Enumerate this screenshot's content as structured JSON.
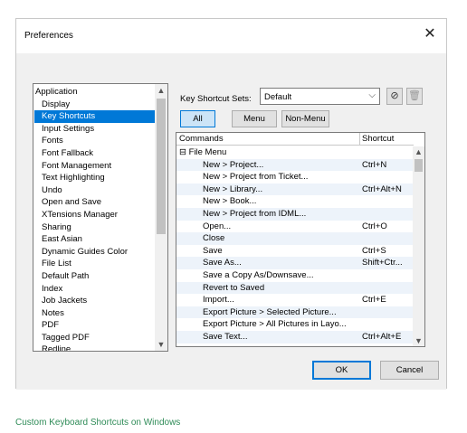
{
  "window": {
    "title": "Preferences",
    "close_glyph": "✕"
  },
  "categories": {
    "items": [
      {
        "label": "Application",
        "top": true,
        "selected": false
      },
      {
        "label": "Display",
        "top": false,
        "selected": false
      },
      {
        "label": "Key Shortcuts",
        "top": false,
        "selected": true
      },
      {
        "label": "Input Settings",
        "top": false,
        "selected": false
      },
      {
        "label": "Fonts",
        "top": false,
        "selected": false
      },
      {
        "label": "Font Fallback",
        "top": false,
        "selected": false
      },
      {
        "label": "Font Management",
        "top": false,
        "selected": false
      },
      {
        "label": "Text Highlighting",
        "top": false,
        "selected": false
      },
      {
        "label": "Undo",
        "top": false,
        "selected": false
      },
      {
        "label": "Open and Save",
        "top": false,
        "selected": false
      },
      {
        "label": "XTensions Manager",
        "top": false,
        "selected": false
      },
      {
        "label": "Sharing",
        "top": false,
        "selected": false
      },
      {
        "label": "East Asian",
        "top": false,
        "selected": false
      },
      {
        "label": "Dynamic Guides Color",
        "top": false,
        "selected": false
      },
      {
        "label": "File List",
        "top": false,
        "selected": false
      },
      {
        "label": "Default Path",
        "top": false,
        "selected": false
      },
      {
        "label": "Index",
        "top": false,
        "selected": false
      },
      {
        "label": "Job Jackets",
        "top": false,
        "selected": false
      },
      {
        "label": "Notes",
        "top": false,
        "selected": false
      },
      {
        "label": "PDF",
        "top": false,
        "selected": false
      },
      {
        "label": "Tagged PDF",
        "top": false,
        "selected": false
      },
      {
        "label": "Redline",
        "top": false,
        "selected": false
      }
    ]
  },
  "shortcut_sets": {
    "label": "Key Shortcut Sets:",
    "selected": "Default",
    "new_icon": "new-set-icon",
    "delete_icon": "trash-icon"
  },
  "filters": {
    "all": "All",
    "menu": "Menu",
    "non_menu": "Non-Menu",
    "selected": "all"
  },
  "commands_table": {
    "col_commands": "Commands",
    "col_shortcut": "Shortcut",
    "rows": [
      {
        "command": "⊟ File Menu",
        "shortcut": "",
        "group": true
      },
      {
        "command": "New > Project...",
        "shortcut": "Ctrl+N",
        "group": false
      },
      {
        "command": "New > Project from Ticket...",
        "shortcut": "",
        "group": false
      },
      {
        "command": "New > Library...",
        "shortcut": "Ctrl+Alt+N",
        "group": false
      },
      {
        "command": "New > Book...",
        "shortcut": "",
        "group": false
      },
      {
        "command": "New > Project from IDML...",
        "shortcut": "",
        "group": false
      },
      {
        "command": "Open...",
        "shortcut": "Ctrl+O",
        "group": false
      },
      {
        "command": "Close",
        "shortcut": "",
        "group": false
      },
      {
        "command": "Save",
        "shortcut": "Ctrl+S",
        "group": false
      },
      {
        "command": "Save As...",
        "shortcut": "Shift+Ctr...",
        "group": false
      },
      {
        "command": "Save a Copy As/Downsave...",
        "shortcut": "",
        "group": false
      },
      {
        "command": "Revert to Saved",
        "shortcut": "",
        "group": false
      },
      {
        "command": "Import...",
        "shortcut": "Ctrl+E",
        "group": false
      },
      {
        "command": "Export Picture > Selected Picture...",
        "shortcut": "",
        "group": false
      },
      {
        "command": "Export Picture > All Pictures in Layo...",
        "shortcut": "",
        "group": false
      },
      {
        "command": "Save Text...",
        "shortcut": "Ctrl+Alt+E",
        "group": false
      }
    ]
  },
  "buttons": {
    "ok": "OK",
    "cancel": "Cancel"
  },
  "caption": "Custom Keyboard Shortcuts on Windows",
  "colors": {
    "selection": "#0078d7",
    "caption": "#2e8b57",
    "row_alt": "#edf3fa"
  }
}
